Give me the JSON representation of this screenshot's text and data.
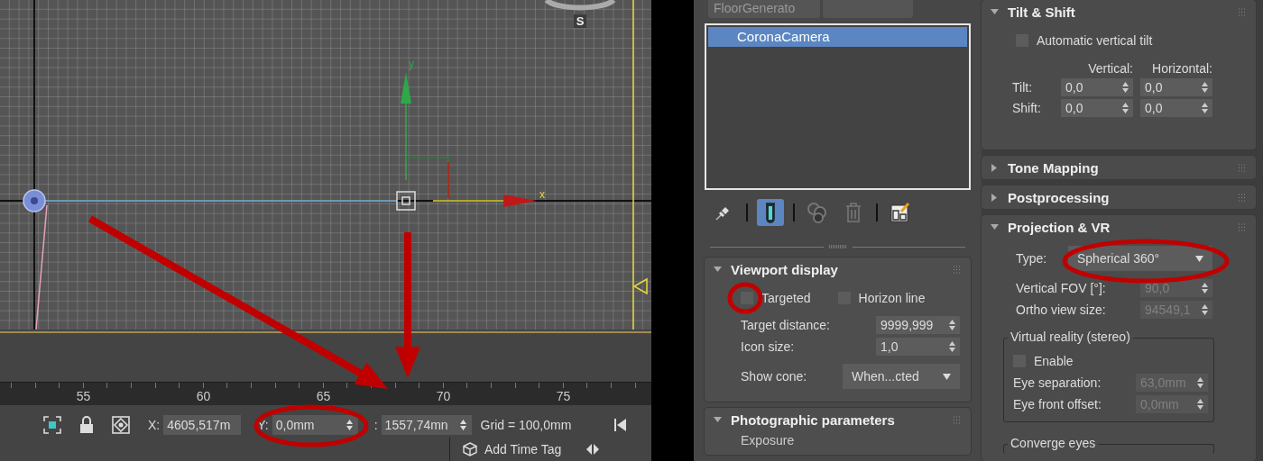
{
  "viewport": {
    "axis_y_label": "y",
    "axis_x_label": "x",
    "compass_label": "S"
  },
  "ruler": {
    "ticks": [
      "55",
      "60",
      "65",
      "70",
      "75"
    ]
  },
  "status_bar": {
    "coords": [
      {
        "label": "X:",
        "value": "4605,517m",
        "spinner": false
      },
      {
        "label": "Y:",
        "value": "0,0mm",
        "spinner": true
      },
      {
        "label": ":",
        "value": "1557,74mn",
        "spinner": true
      }
    ],
    "grid": "Grid = 100,0mm",
    "time_tag": "Add Time Tag"
  },
  "modifier_stack": {
    "tab": "FloorGenerato",
    "items": [
      {
        "label": "CoronaCamera",
        "selected": true
      }
    ],
    "tools": [
      {
        "kind": "pin",
        "selected": false
      },
      {
        "kind": "result",
        "selected": true
      },
      {
        "kind": "unique",
        "selected": false
      },
      {
        "kind": "delete",
        "selected": false
      },
      {
        "kind": "configure",
        "selected": false
      }
    ]
  },
  "middle_rollouts": [
    {
      "title": "Viewport display",
      "expanded": true,
      "controls": [
        {
          "kind": "checks",
          "items": [
            {
              "label": "Targeted",
              "checked": false
            },
            {
              "label": "Horizon line",
              "checked": false
            }
          ]
        },
        {
          "kind": "spinner",
          "label": "Target distance:",
          "value": "9999,999",
          "disabled": false
        },
        {
          "kind": "spinner",
          "label": "Icon size:",
          "value": "1,0",
          "disabled": false
        },
        {
          "kind": "dropdown",
          "label": "Show cone:",
          "value": "When...cted"
        }
      ]
    },
    {
      "title": "Photographic parameters",
      "expanded": true,
      "controls": [
        {
          "kind": "label",
          "label": "Exposure"
        }
      ]
    }
  ],
  "right_rollouts": [
    {
      "title": "Tilt & Shift",
      "expanded": true,
      "controls": [
        {
          "kind": "checks",
          "items": [
            {
              "label": "Automatic vertical tilt",
              "checked": false
            }
          ]
        },
        {
          "kind": "table",
          "headers": [
            "Vertical:",
            "Horizontal:"
          ],
          "rows": [
            {
              "label": "Tilt:",
              "values": [
                "0,0",
                "0,0"
              ]
            },
            {
              "label": "Shift:",
              "values": [
                "0,0",
                "0,0"
              ]
            }
          ]
        }
      ]
    },
    {
      "title": "Tone Mapping",
      "expanded": false
    },
    {
      "title": "Postprocessing",
      "expanded": false
    },
    {
      "title": "Projection & VR",
      "expanded": true,
      "controls": [
        {
          "kind": "dropdown",
          "label": "Type:",
          "value": "Spherical 360°"
        },
        {
          "kind": "spinner",
          "label": "Vertical FOV [°]:",
          "value": "90,0",
          "disabled": true
        },
        {
          "kind": "spinner",
          "label": "Ortho view size:",
          "value": "94549,1",
          "disabled": true
        },
        {
          "kind": "group",
          "title": "Virtual reality (stereo)",
          "controls": [
            {
              "kind": "checks",
              "items": [
                {
                  "label": "Enable",
                  "checked": false
                }
              ]
            },
            {
              "kind": "spinner",
              "label": "Eye separation:",
              "value": "63,0mm",
              "disabled": true
            },
            {
              "kind": "spinner",
              "label": "Eye front offset:",
              "value": "0,0mm",
              "disabled": true
            }
          ]
        },
        {
          "kind": "group",
          "title": "Converge eyes"
        }
      ]
    }
  ]
}
